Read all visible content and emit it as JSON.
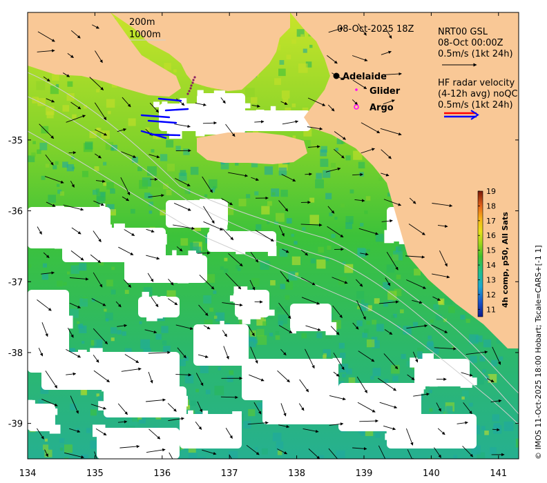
{
  "map": {
    "title": "08-Oct-2025 18Z",
    "bathymetry_labels": [
      "200m",
      "1000m"
    ],
    "places": [
      {
        "name": "Adelaide",
        "marker": "black-dot"
      },
      {
        "name": "Glider",
        "marker": "magenta-dot"
      },
      {
        "name": "Argo",
        "marker": "magenta-circle"
      }
    ],
    "current_model": {
      "lines": [
        "NRT00 GSL",
        "08-Oct 00:00Z",
        "0.5m/s (1kt 24h)"
      ]
    },
    "hf_radar": {
      "lines": [
        "HF radar velocity",
        "(4-12h avg) noQC",
        "0.5m/s (1kt 24h)"
      ]
    },
    "axes": {
      "x_ticks": [
        "134",
        "135",
        "136",
        "137",
        "138",
        "139",
        "140",
        "141"
      ],
      "y_ticks": [
        "-35",
        "-36",
        "-37",
        "-38",
        "-39"
      ],
      "xlim": [
        134,
        141.3
      ],
      "ylim": [
        -39.5,
        -33.2
      ]
    },
    "colorbar": {
      "label": "4h comp, p50, All Sats",
      "ticks": [
        "19",
        "18",
        "17",
        "16",
        "15",
        "14",
        "13",
        "12",
        "11"
      ],
      "range": [
        10.5,
        19
      ]
    },
    "credit": "© IMOS 11-Oct-2025 18:00 Hobart; Tscale=CARS+[-1 1]",
    "colors": {
      "land": "#f9c896",
      "no_data": "#ffffff",
      "model_arrow": "#000000",
      "radar_arrow_fwd": "#ff0000",
      "radar_arrow_back": "#0000ff",
      "glider": "#ff00ff",
      "bathymetry_contour": "#d0d0d0"
    }
  }
}
